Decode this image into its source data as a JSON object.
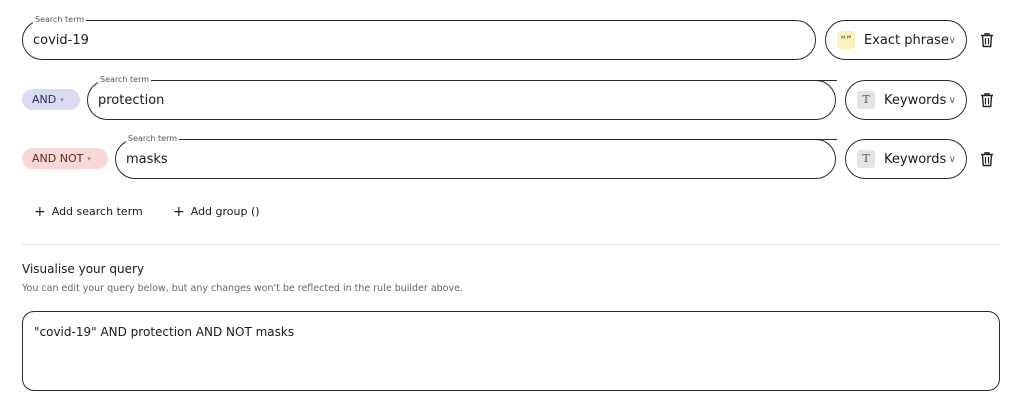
{
  "rows": [
    {
      "legend": "Search term",
      "value": "covid-19",
      "type_label": "Exact phrase",
      "type_icon": "quote-icon"
    },
    {
      "operator": "AND",
      "legend": "Search term",
      "value": "protection",
      "type_label": "Keywords",
      "type_icon": "text-type-icon"
    },
    {
      "operator": "AND NOT",
      "legend": "Search term",
      "value": "masks",
      "type_label": "Keywords",
      "type_icon": "text-type-icon"
    }
  ],
  "icons": {
    "quote_glyph": "“”",
    "keyword_glyph": "T",
    "caret_glyph": "▾",
    "select_caret_glyph": "∨",
    "plus_glyph": "+"
  },
  "actions": {
    "add_search_term": "Add search term",
    "add_group": "Add group ()"
  },
  "visualise": {
    "title": "Visualise your query",
    "subtitle": "You can edit your query below, but any changes won't be reflected in the rule builder above.",
    "query": "\"covid-19\" AND protection AND NOT masks"
  },
  "colors": {
    "and_pill": "#d9dcf0",
    "and_not_pill": "#f7d8d4",
    "exact_phrase_icon_bg": "#fbf2c2",
    "keyword_icon_bg": "#e4e4e4",
    "border": "#2a2a2a"
  }
}
